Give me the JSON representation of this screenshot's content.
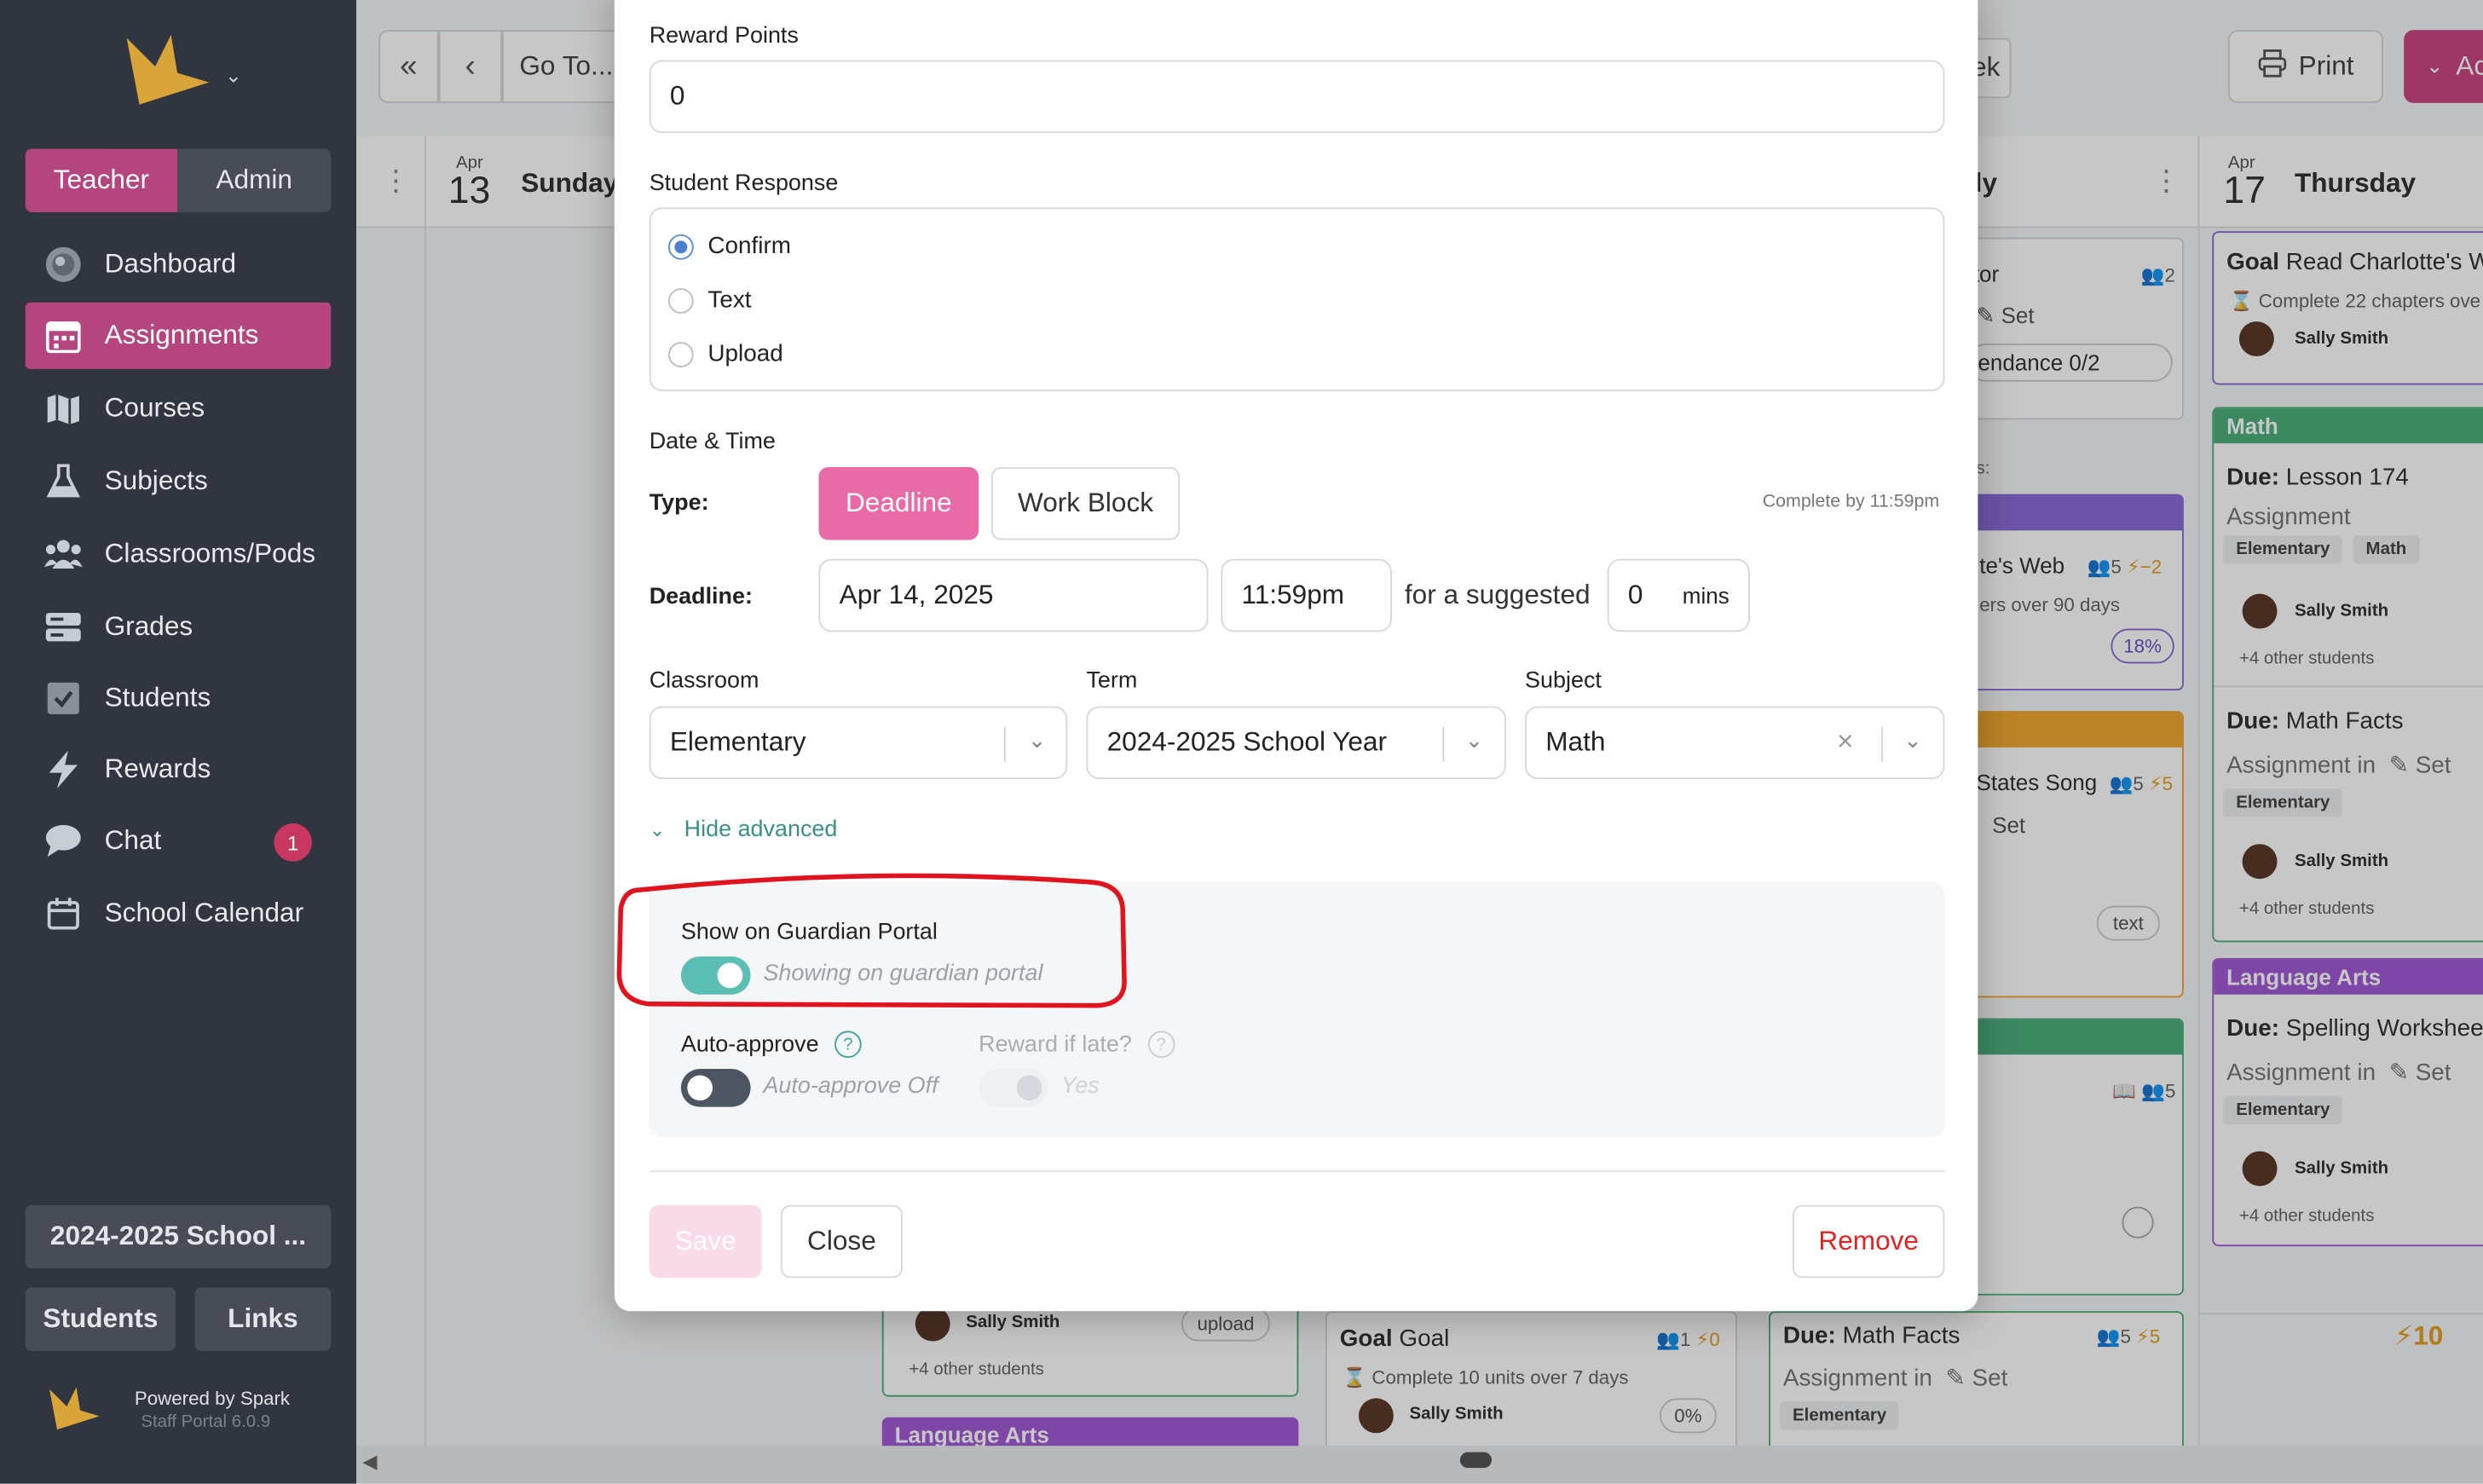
{
  "sidebar": {
    "roles": {
      "teacher": "Teacher",
      "admin": "Admin"
    },
    "nav": [
      {
        "label": "Dashboard",
        "icon": "dashboard-icon"
      },
      {
        "label": "Assignments",
        "icon": "calendar-icon"
      },
      {
        "label": "Courses",
        "icon": "map-icon"
      },
      {
        "label": "Subjects",
        "icon": "flask-icon"
      },
      {
        "label": "Classrooms/Pods",
        "icon": "people-icon"
      },
      {
        "label": "Grades",
        "icon": "grades-icon"
      },
      {
        "label": "Students",
        "icon": "students-icon"
      },
      {
        "label": "Rewards",
        "icon": "bolt-icon"
      },
      {
        "label": "Chat",
        "icon": "chat-icon",
        "badge": "1"
      },
      {
        "label": "School Calendar",
        "icon": "calendar-outline-icon"
      }
    ],
    "year_button": "2024-2025 School ...",
    "students_button": "Students",
    "links_button": "Links",
    "powered_by": "Powered by Spark",
    "version": "Staff Portal 6.0.9"
  },
  "toolbar": {
    "goto": "Go To...",
    "week_fragment": "ek",
    "print": "Print",
    "add_fragment": "Ac"
  },
  "calendar": {
    "sunday": {
      "month": "Apr",
      "day": "13",
      "name": "Sunday"
    },
    "wed_fragment": "ly",
    "thursday": {
      "month": "Apr",
      "day": "17",
      "name": "Thursday"
    },
    "col_wed": {
      "card1": {
        "title": "tor",
        "people": "2",
        "set": "Set",
        "attendance": "endance 0/2"
      },
      "card2_label": "s:",
      "card2": {
        "title": "te's Web",
        "people": "5",
        "reward": "−2",
        "sub": "ers over 90 days",
        "pct": "18%"
      },
      "card3": {
        "title": "States Song",
        "people": "5",
        "reward": "5",
        "set": "Set",
        "tag": "text"
      },
      "card4": {
        "people": "5"
      }
    },
    "col_thu": {
      "goal_prefix": "Goal",
      "goal": "Read Charlotte's W",
      "goal_sub": "Complete 22 chapters ove",
      "student": "Sally Smith",
      "math_header": "Math",
      "due_prefix": "Due:",
      "due1": "Lesson 174",
      "assignment_label": "Assignment",
      "tag_elem": "Elementary",
      "tag_math": "Math",
      "others": "+4 other students",
      "due2": "Math Facts",
      "assignment_in": "Assignment in",
      "set": "Set",
      "la_header": "Language Arts",
      "due3": "Spelling Workshee",
      "total": "10"
    },
    "bottom": {
      "student": "Sally Smith",
      "upload": "upload",
      "others": "+4 other students",
      "la_header": "Language Arts",
      "goal_prefix": "Goal",
      "goal_title": "Goal",
      "goal_people": "1",
      "goal_reward": "0",
      "goal_sub": "Complete 10 units over 7 days",
      "goal_pct": "0%",
      "due_prefix": "Due:",
      "due_title": "Math Facts",
      "due_people": "5",
      "due_reward": "5",
      "assignment_in": "Assignment in",
      "set": "Set",
      "tag_elem": "Elementary"
    }
  },
  "modal": {
    "reward_points_label": "Reward Points",
    "reward_points_value": "0",
    "student_response_label": "Student Response",
    "responses": [
      "Confirm",
      "Text",
      "Upload"
    ],
    "selected_response": "Confirm",
    "date_time_label": "Date & Time",
    "type_label": "Type:",
    "type_deadline": "Deadline",
    "type_workblock": "Work Block",
    "complete_by": "Complete by 11:59pm",
    "deadline_label": "Deadline:",
    "deadline_date": "Apr 14, 2025",
    "deadline_time": "11:59pm",
    "suggested_label": "for a suggested",
    "suggested_value": "0",
    "suggested_unit": "mins",
    "classroom_label": "Classroom",
    "classroom_value": "Elementary",
    "term_label": "Term",
    "term_value": "2024-2025 School Year",
    "subject_label": "Subject",
    "subject_value": "Math",
    "hide_advanced": "Hide advanced",
    "guardian_label": "Show on Guardian Portal",
    "guardian_status": "Showing on guardian portal",
    "guardian_on": true,
    "auto_approve_label": "Auto-approve",
    "auto_approve_status": "Auto-approve Off",
    "reward_late_label": "Reward if late?",
    "reward_late_status": "Yes",
    "save": "Save",
    "close": "Close",
    "remove": "Remove"
  },
  "colors": {
    "sidebar_bg": "#30353f",
    "accent_pink": "#b5457f",
    "deadline_pink": "#e86aa6",
    "toggle_teal": "#5bbfb5",
    "math_green": "#4caf7d",
    "la_purple": "#a25bd6",
    "orange": "#f0a830",
    "remove_red": "#e02424",
    "annotation_red": "#e0141e"
  }
}
